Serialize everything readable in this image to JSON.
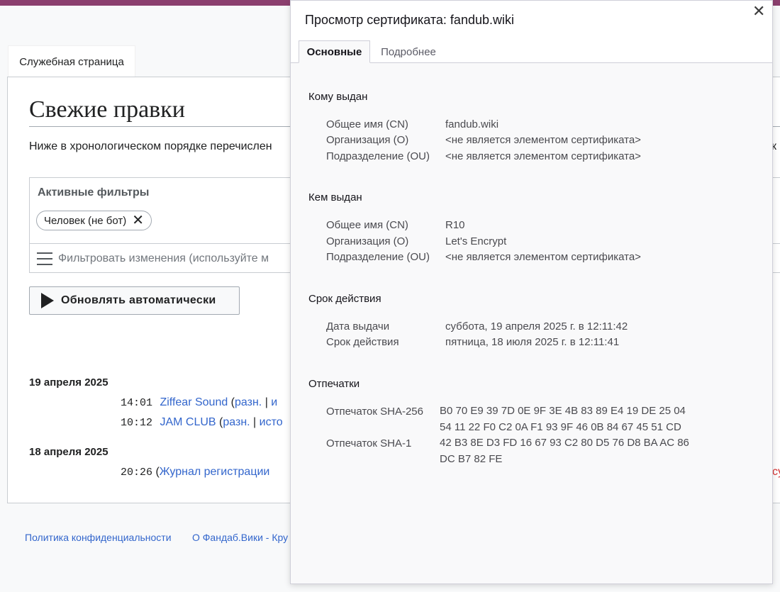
{
  "wiki": {
    "tab_label": "Служебная страница",
    "page_title": "Свежие правки",
    "intro_text": "Ниже в хронологическом порядке перечислен",
    "intro_tail": "к",
    "filters": {
      "heading": "Активные фильтры",
      "chip_label": "Человек (не бот)",
      "chip_close": "✕",
      "input_placeholder": "Фильтровать изменения (используйте м"
    },
    "auto_update_label": "Обновлять автоматически",
    "days": [
      {
        "date": "19 апреля 2025",
        "changes": [
          {
            "time": "14:01",
            "title": "Ziffear Sound",
            "open": " (",
            "diff": "разн.",
            "sep": " | ",
            "hist": "и"
          },
          {
            "time": "10:12",
            "title": "JAM CLUB",
            "open": " (",
            "diff": "разн.",
            "sep": " | ",
            "hist": "исто"
          }
        ]
      },
      {
        "date": "18 апреля 2025",
        "changes": [
          {
            "time": "20:26",
            "open": " (",
            "title": "Журнал регистрации"
          }
        ]
      }
    ],
    "red_tail": "су",
    "footer": {
      "privacy": "Политика конфиденциальности",
      "about": "О Фандаб.Вики - Кру"
    }
  },
  "certificate": {
    "title": "Просмотр сертификата: fandub.wiki",
    "close": "✕",
    "tabs": [
      "Основные",
      "Подробнее"
    ],
    "issued_to": {
      "heading": "Кому выдан",
      "rows": [
        {
          "label": "Общее имя (CN)",
          "value": "fandub.wiki"
        },
        {
          "label": "Организация (O)",
          "value": "<не является элементом сертификата>"
        },
        {
          "label": "Подразделение (OU)",
          "value": "<не является элементом сертификата>"
        }
      ]
    },
    "issued_by": {
      "heading": "Кем выдан",
      "rows": [
        {
          "label": "Общее имя (CN)",
          "value": "R10"
        },
        {
          "label": "Организация (O)",
          "value": "Let's Encrypt"
        },
        {
          "label": "Подразделение (OU)",
          "value": "<не является элементом сертификата>"
        }
      ]
    },
    "validity": {
      "heading": "Срок действия",
      "rows": [
        {
          "label": "Дата выдачи",
          "value": "суббота, 19 апреля 2025 г. в 12:11:42"
        },
        {
          "label": "Срок действия",
          "value": "пятница, 18 июля 2025 г. в 12:11:41"
        }
      ]
    },
    "fingerprints": {
      "heading": "Отпечатки",
      "sha256_label": "Отпечаток SHA-256",
      "sha256_line1": "B0 70 E9 39 7D 0E 9F 3E 4B 83 89 E4 19 DE 25 04",
      "sha256_line2": "54 11 22 F0 C2 0A F1 93 9F 46 0B 84 67 45 51 CD",
      "sha1_label": "Отпечаток SHA-1",
      "sha1_line1": "42 B3 8E D3 FD 16 67 93 C2 80 D5 76 D8 BA AC 86",
      "sha1_line2": "DC B7 82 FE"
    }
  }
}
